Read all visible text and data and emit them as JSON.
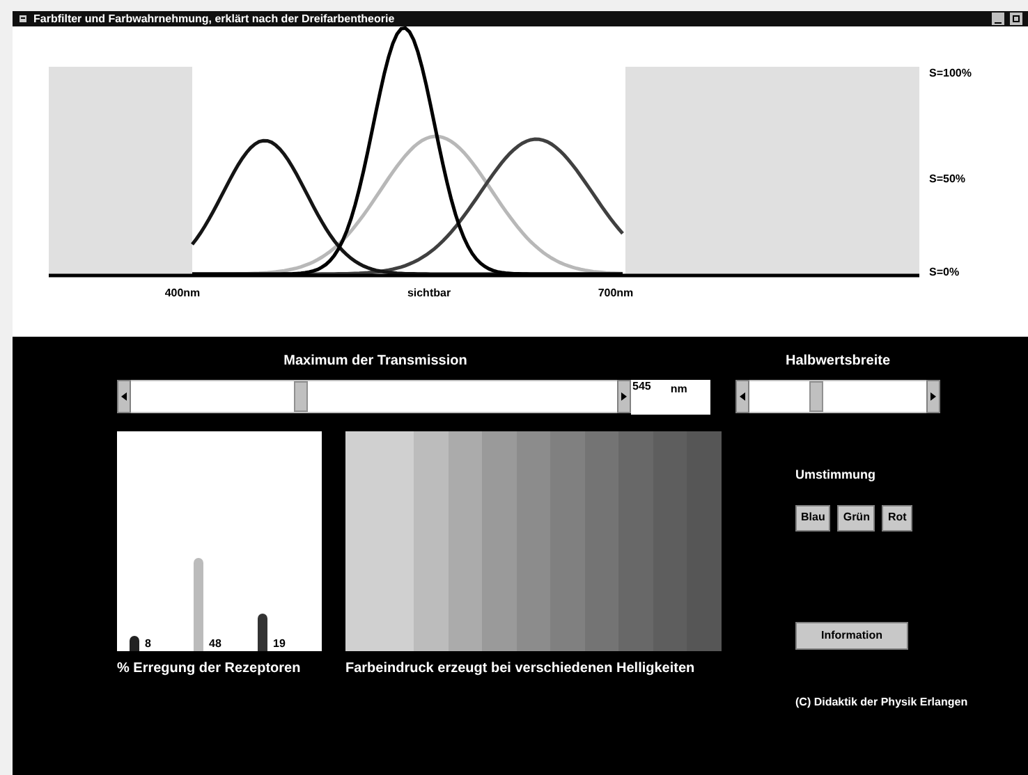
{
  "window": {
    "title": "Farbfilter und Farbwahrnehmung, erklärt nach der Dreifarbentheorie"
  },
  "spectrum": {
    "axis_labels": [
      "400nm",
      "sichtbar",
      "700nm"
    ],
    "s_labels": [
      "S=100%",
      "S=50%",
      "S=0%"
    ]
  },
  "transmission": {
    "label": "Maximum der Transmission",
    "level": 0.35,
    "value": "545",
    "unit": "nm"
  },
  "halfwidth": {
    "label": "Halbwertsbreite",
    "level": 0.38
  },
  "receptors": {
    "caption": "% Erregung der Rezeptoren",
    "bars": [
      {
        "value": "8",
        "level": 0.08,
        "color": "#222222"
      },
      {
        "value": "48",
        "level": 0.48,
        "color": "#bbbbbb"
      },
      {
        "value": "19",
        "level": 0.19,
        "color": "#333333"
      }
    ]
  },
  "brightness": {
    "caption": "Farbeindruck erzeugt bei verschiedenen Helligkeiten",
    "stripes": [
      {
        "color": "#d0d0d0"
      },
      {
        "color": "#d0d0d0"
      },
      {
        "color": "#bcbcbc"
      },
      {
        "color": "#ababab"
      },
      {
        "color": "#9a9a9a"
      },
      {
        "color": "#8c8c8c"
      },
      {
        "color": "#808080"
      },
      {
        "color": "#747474"
      },
      {
        "color": "#686868"
      },
      {
        "color": "#5e5e5e"
      },
      {
        "color": "#565656"
      }
    ]
  },
  "adaptation": {
    "label": "Umstimmung",
    "buttons": [
      "Blau",
      "Grün",
      "Rot"
    ]
  },
  "info_button": "Information",
  "copyright": "(C) Didaktik der Physik Erlangen"
}
